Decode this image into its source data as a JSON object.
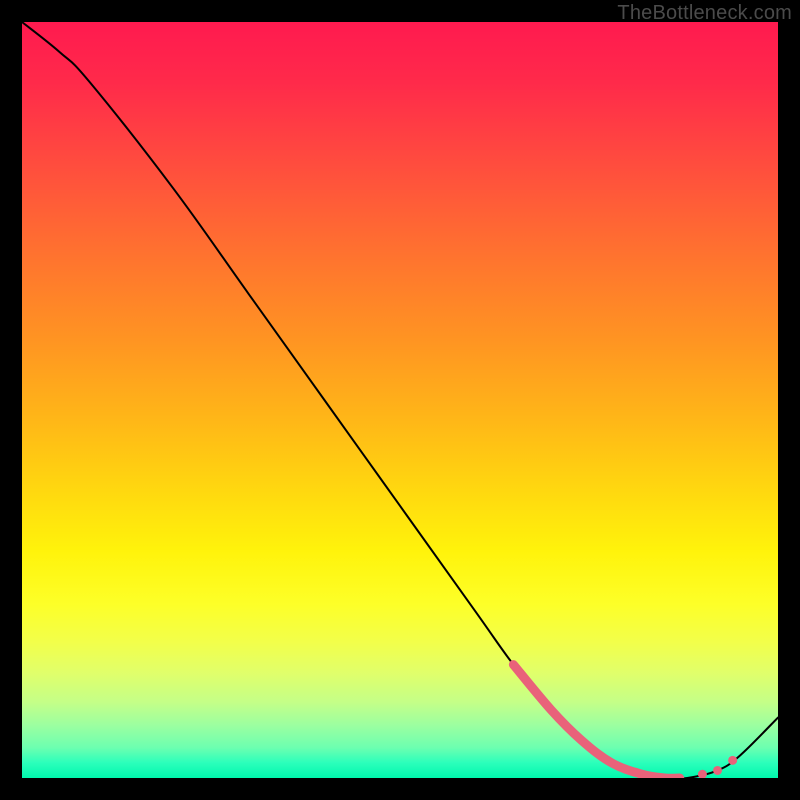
{
  "attribution": "TheBottleneck.com",
  "chart_data": {
    "type": "line",
    "title": "",
    "xlabel": "",
    "ylabel": "",
    "xlim": [
      0,
      100
    ],
    "ylim": [
      0,
      100
    ],
    "series": [
      {
        "name": "bottleneck-curve",
        "x": [
          0,
          5,
          9,
          20,
          30,
          40,
          50,
          60,
          65,
          70,
          74,
          78,
          82,
          85,
          88,
          92,
          95,
          100
        ],
        "y": [
          100,
          96,
          92,
          78,
          64,
          50,
          36,
          22,
          15,
          9,
          5,
          2,
          0.5,
          0,
          0,
          1,
          3,
          8
        ]
      }
    ],
    "highlight_points": {
      "name": "optimal-zone-markers",
      "color": "#e9627a",
      "segment_x_range": [
        65,
        87
      ],
      "dots_x": [
        90,
        92,
        94
      ]
    },
    "gradient_stops": [
      {
        "pos": 0.0,
        "color": "#ff1a4f"
      },
      {
        "pos": 0.5,
        "color": "#ffb817"
      },
      {
        "pos": 0.75,
        "color": "#fff30b"
      },
      {
        "pos": 1.0,
        "color": "#00f7ad"
      }
    ]
  }
}
